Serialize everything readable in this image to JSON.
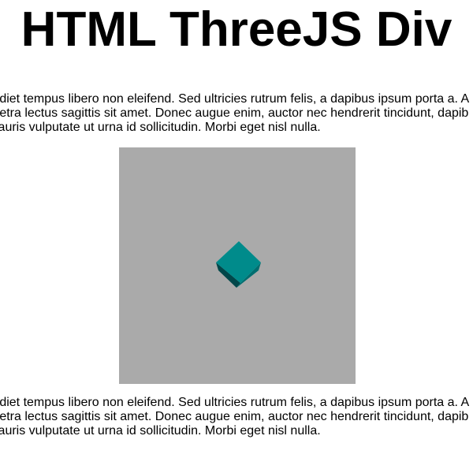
{
  "page": {
    "title": "HTML ThreeJS Div"
  },
  "paragraph_top": {
    "lines": [
      "rdiet tempus libero non eleifend. Sed ultricies rutrum felis, a dapibus ipsum porta a. A",
      "retra lectus sagittis sit amet. Donec augue enim, auctor nec hendrerit tincidunt, dapib",
      "lauris vulputate ut urna id sollicitudin. Morbi eget nisl nulla."
    ]
  },
  "paragraph_bottom": {
    "lines": [
      "rdiet tempus libero non eleifend. Sed ultricies rutrum felis, a dapibus ipsum porta a. A",
      "retra lectus sagittis sit amet. Donec augue enim, auctor nec hendrerit tincidunt, dapib",
      "lauris vulputate ut urna id sollicitudin. Morbi eget nisl nulla."
    ]
  },
  "scene": {
    "background_color": "#aaaaaa",
    "cube": {
      "top_color": "#008b8b",
      "side_color": "#00474a",
      "front_color": "#006e70"
    }
  }
}
